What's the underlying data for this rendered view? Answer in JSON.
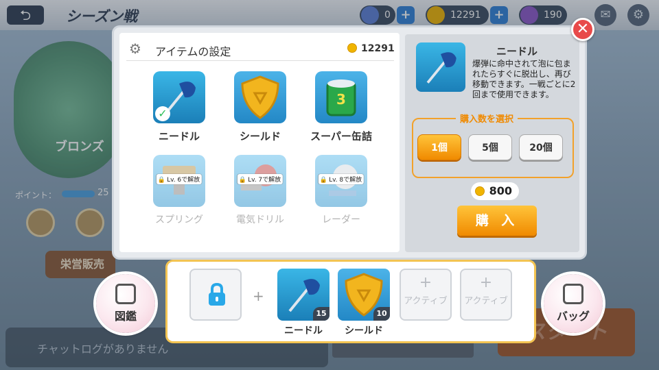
{
  "header": {
    "back_glyph": "⮌",
    "title": "シーズン戦",
    "gems": "0",
    "coins": "12291",
    "tickets": "190"
  },
  "background": {
    "rank": "ブロンズ",
    "points_label": "ポイント：",
    "points_value": "25",
    "eiyo_button": "栄営販売",
    "chat_placeholder": "チャットログがありません",
    "start_button": "スタート",
    "collection_button": "図鑑",
    "bag_button": "バッグ"
  },
  "settings": {
    "title": "アイテムの設定",
    "coin_balance": "12291",
    "items": [
      {
        "name": "ニードル",
        "locked": false,
        "selected": true
      },
      {
        "name": "シールド",
        "locked": false,
        "selected": false
      },
      {
        "name": "スーパー缶詰",
        "locked": false,
        "selected": false
      },
      {
        "name": "スプリング",
        "locked": true,
        "unlock": "Lv. 6で解放"
      },
      {
        "name": "電気ドリル",
        "locked": true,
        "unlock": "Lv. 7で解放"
      },
      {
        "name": "レーダー",
        "locked": true,
        "unlock": "Lv. 8で解放"
      }
    ]
  },
  "detail": {
    "name": "ニードル",
    "description": "爆弾に命中されて泡に包まれたらすぐに脱出し、再び移動できます。一戦ごとに2回まで使用できます。",
    "qty_label": "購入数を選択",
    "qty_options": [
      "1個",
      "5個",
      "20個"
    ],
    "selected_qty": "1個",
    "price": "800",
    "buy_label": "購 入",
    "close_glyph": "✕"
  },
  "slots": {
    "plus": "+",
    "equipped": [
      {
        "name": "ニードル",
        "count": "15"
      },
      {
        "name": "シールド",
        "count": "10"
      }
    ],
    "empty_label": "アクティブ",
    "empty_plus": "+"
  },
  "colors": {
    "accent_orange": "#f08a00",
    "close_red": "#e84a4a",
    "needle_blue": "#1f5fb0",
    "shield_gold": "#f2b51e",
    "can_green": "#2aa84a"
  }
}
